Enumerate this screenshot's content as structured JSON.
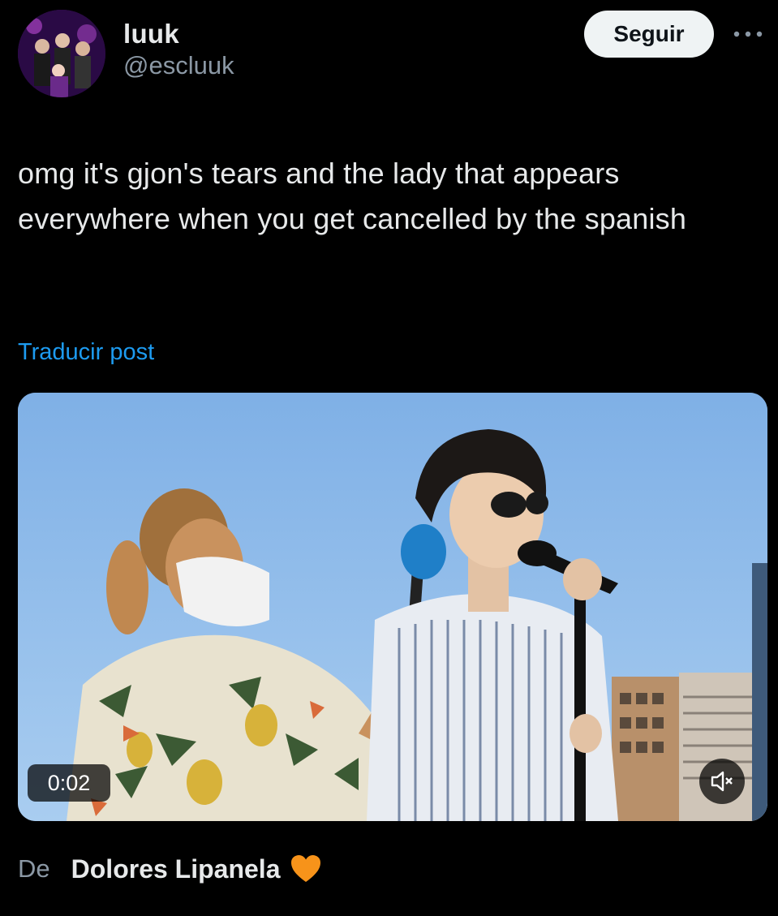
{
  "post": {
    "author": {
      "display_name": "luuk",
      "handle": "@escluuk"
    },
    "follow_label": "Seguir",
    "more_icon": "more-horizontal-icon",
    "text": "omg it's gjon's tears and the lady that appears everywhere when you get cancelled by the spanish",
    "translate_label": "Traducir post",
    "video": {
      "timestamp": "0:02",
      "mute_icon": "volume-muted-icon"
    },
    "source": {
      "prefix": "De",
      "name": "Dolores Lipanela",
      "emoji_icon": "orange-heart-icon"
    }
  },
  "colors": {
    "background": "#000000",
    "text_primary": "#e7e9ea",
    "text_secondary": "#8b98a5",
    "link": "#1d9bf0",
    "follow_bg": "#eff3f4",
    "heart": "#f7931a"
  }
}
